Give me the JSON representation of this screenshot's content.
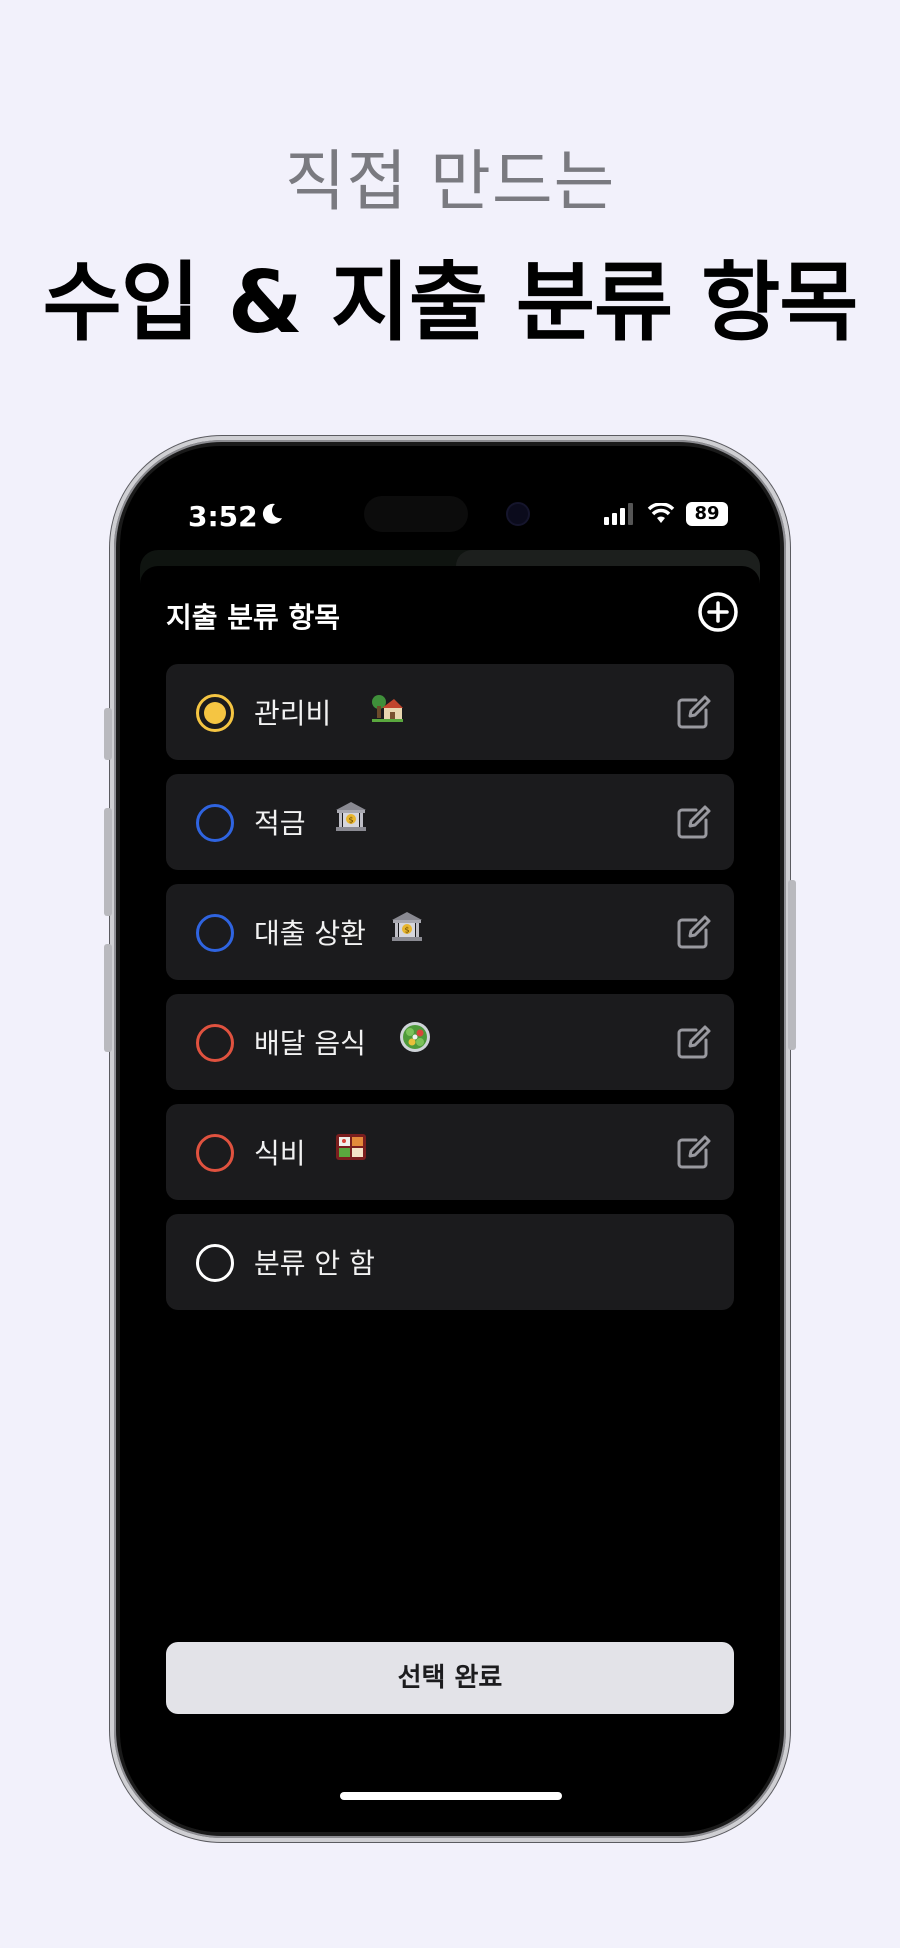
{
  "promo": {
    "subtitle": "직접 만드는",
    "title": "수입 & 지출 분류 항목"
  },
  "status_bar": {
    "time": "3:52",
    "battery": "89"
  },
  "sheet": {
    "title": "지출 분류 항목"
  },
  "categories": [
    {
      "label": "관리비",
      "emoji": "house-with-garden",
      "color": "#f5c542",
      "selected": true,
      "editable": true
    },
    {
      "label": "적금",
      "emoji": "bank",
      "color": "#2f64e0",
      "selected": false,
      "editable": true
    },
    {
      "label": "대출 상환",
      "emoji": "bank",
      "color": "#2f64e0",
      "selected": false,
      "editable": true
    },
    {
      "label": "배달 음식",
      "emoji": "salad",
      "color": "#e0523f",
      "selected": false,
      "editable": true
    },
    {
      "label": "식비",
      "emoji": "bento-box",
      "color": "#e0523f",
      "selected": false,
      "editable": true
    },
    {
      "label": "분류 안 함",
      "emoji": "",
      "color": "#ffffff",
      "selected": false,
      "editable": false
    }
  ],
  "done_button": "선택 완료"
}
